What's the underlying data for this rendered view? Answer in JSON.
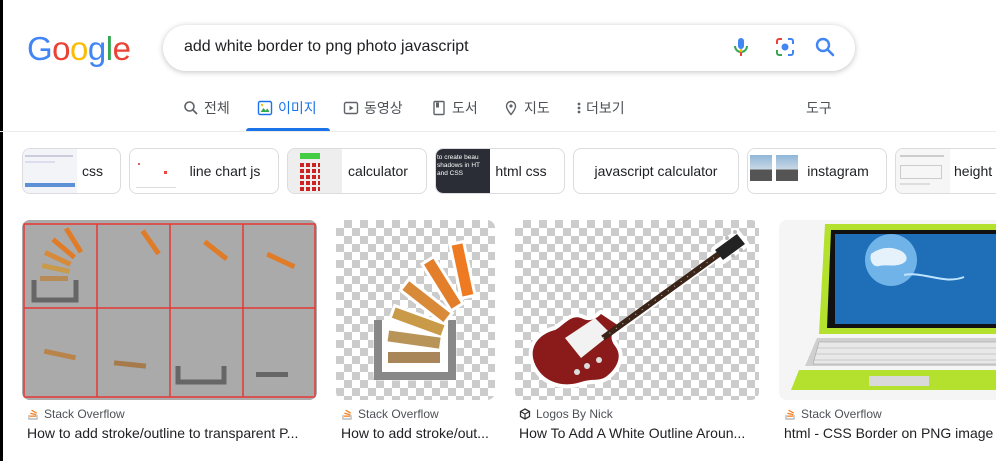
{
  "logo": {
    "text": "Google",
    "letters": [
      {
        "ch": "G",
        "color": "#4285F4"
      },
      {
        "ch": "o",
        "color": "#EA4335"
      },
      {
        "ch": "o",
        "color": "#FBBC05"
      },
      {
        "ch": "g",
        "color": "#4285F4"
      },
      {
        "ch": "l",
        "color": "#34A853"
      },
      {
        "ch": "e",
        "color": "#EA4335"
      }
    ]
  },
  "search": {
    "query": "add white border to png photo javascript",
    "icons": [
      "microphone-icon",
      "camera-lens-icon",
      "search-icon"
    ]
  },
  "tabs": [
    {
      "label": "전체",
      "icon": "search-icon",
      "active": false
    },
    {
      "label": "이미지",
      "icon": "image-icon",
      "active": true
    },
    {
      "label": "동영상",
      "icon": "play-icon",
      "active": false
    },
    {
      "label": "도서",
      "icon": "book-icon",
      "active": false
    },
    {
      "label": "지도",
      "icon": "map-pin-icon",
      "active": false
    },
    {
      "label": "더보기",
      "icon": "more-vert-icon",
      "active": false
    }
  ],
  "tools_label": "도구",
  "chips": [
    {
      "label": "css"
    },
    {
      "label": "line chart js"
    },
    {
      "label": "calculator"
    },
    {
      "label": "html css"
    },
    {
      "label": "javascript calculator"
    },
    {
      "label": "instagram"
    },
    {
      "label": "height"
    }
  ],
  "chip_thumb_text": "to create beau shadows in HT and CSS",
  "results": [
    {
      "source": "Stack Overflow",
      "title": "How to add stroke/outline to transparent P...",
      "source_icon": "stack-overflow-icon"
    },
    {
      "source": "Stack Overflow",
      "title": "How to add stroke/out...",
      "source_icon": "stack-overflow-icon"
    },
    {
      "source": "Logos By Nick",
      "title": "How To Add A White Outline Aroun...",
      "source_icon": "cube-logo-icon"
    },
    {
      "source": "Stack Overflow",
      "title": "html - CSS Border on PNG image",
      "source_icon": "stack-overflow-icon"
    }
  ],
  "colors": {
    "accent": "#1a73e8",
    "so_orange": "#f48024",
    "grid_red": "#e53935"
  }
}
